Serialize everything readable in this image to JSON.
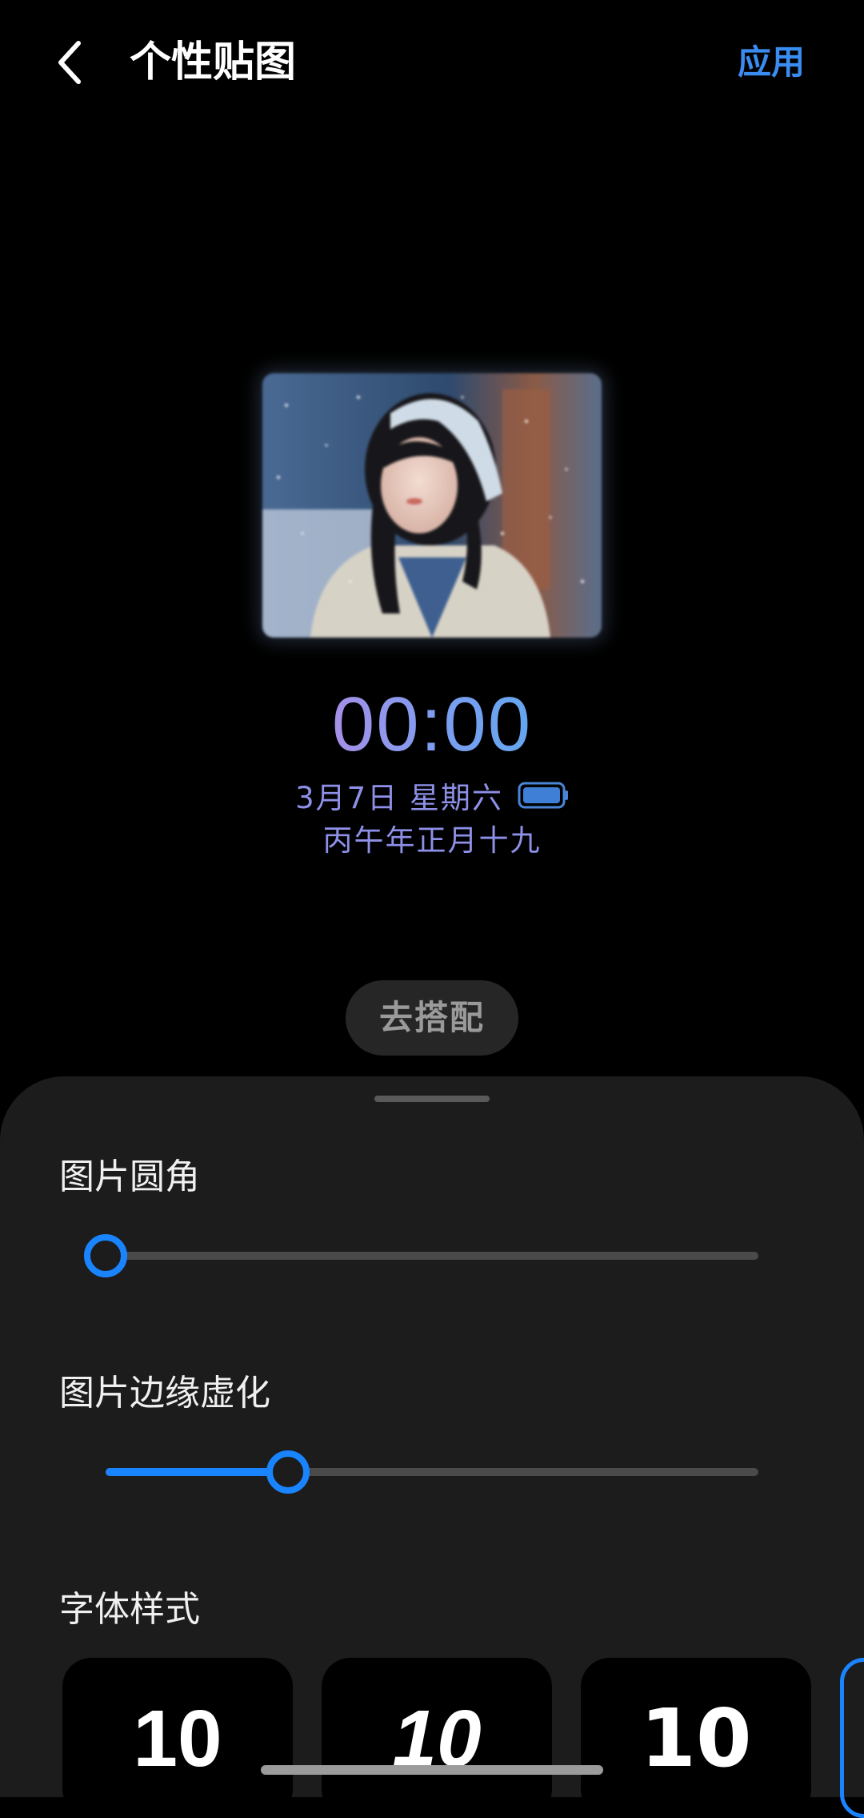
{
  "header": {
    "title": "个性贴图",
    "apply_label": "应用",
    "back_icon": "chevron-left-icon"
  },
  "preview": {
    "image_description_icon": "portrait-sticker-image",
    "clock_time": "00:00",
    "date_text": "3月7日 星期六",
    "lunar_date": "丙午年正月十九",
    "battery_icon": "battery-icon",
    "battery_level": 1.0
  },
  "match_button": {
    "label": "去搭配"
  },
  "sheet": {
    "corner_radius_section": {
      "label": "图片圆角",
      "value": 0.0
    },
    "edge_blur_section": {
      "label": "图片边缘虚化",
      "value": 0.28
    },
    "font_style_section": {
      "label": "字体样式",
      "options": [
        {
          "sample": "10",
          "selected": false
        },
        {
          "sample": "10",
          "selected": false
        },
        {
          "sample": "10",
          "selected": false
        },
        {
          "sample": "",
          "selected": true
        }
      ]
    }
  },
  "colors": {
    "accent": "#1a84ff",
    "apply_text": "#3b8cf0",
    "clock_gradient_start": "#a590e6",
    "clock_gradient_end": "#64a6ee",
    "date_text": "#8e90e8",
    "sheet_bg": "#1c1c1c",
    "background": "#000000"
  }
}
